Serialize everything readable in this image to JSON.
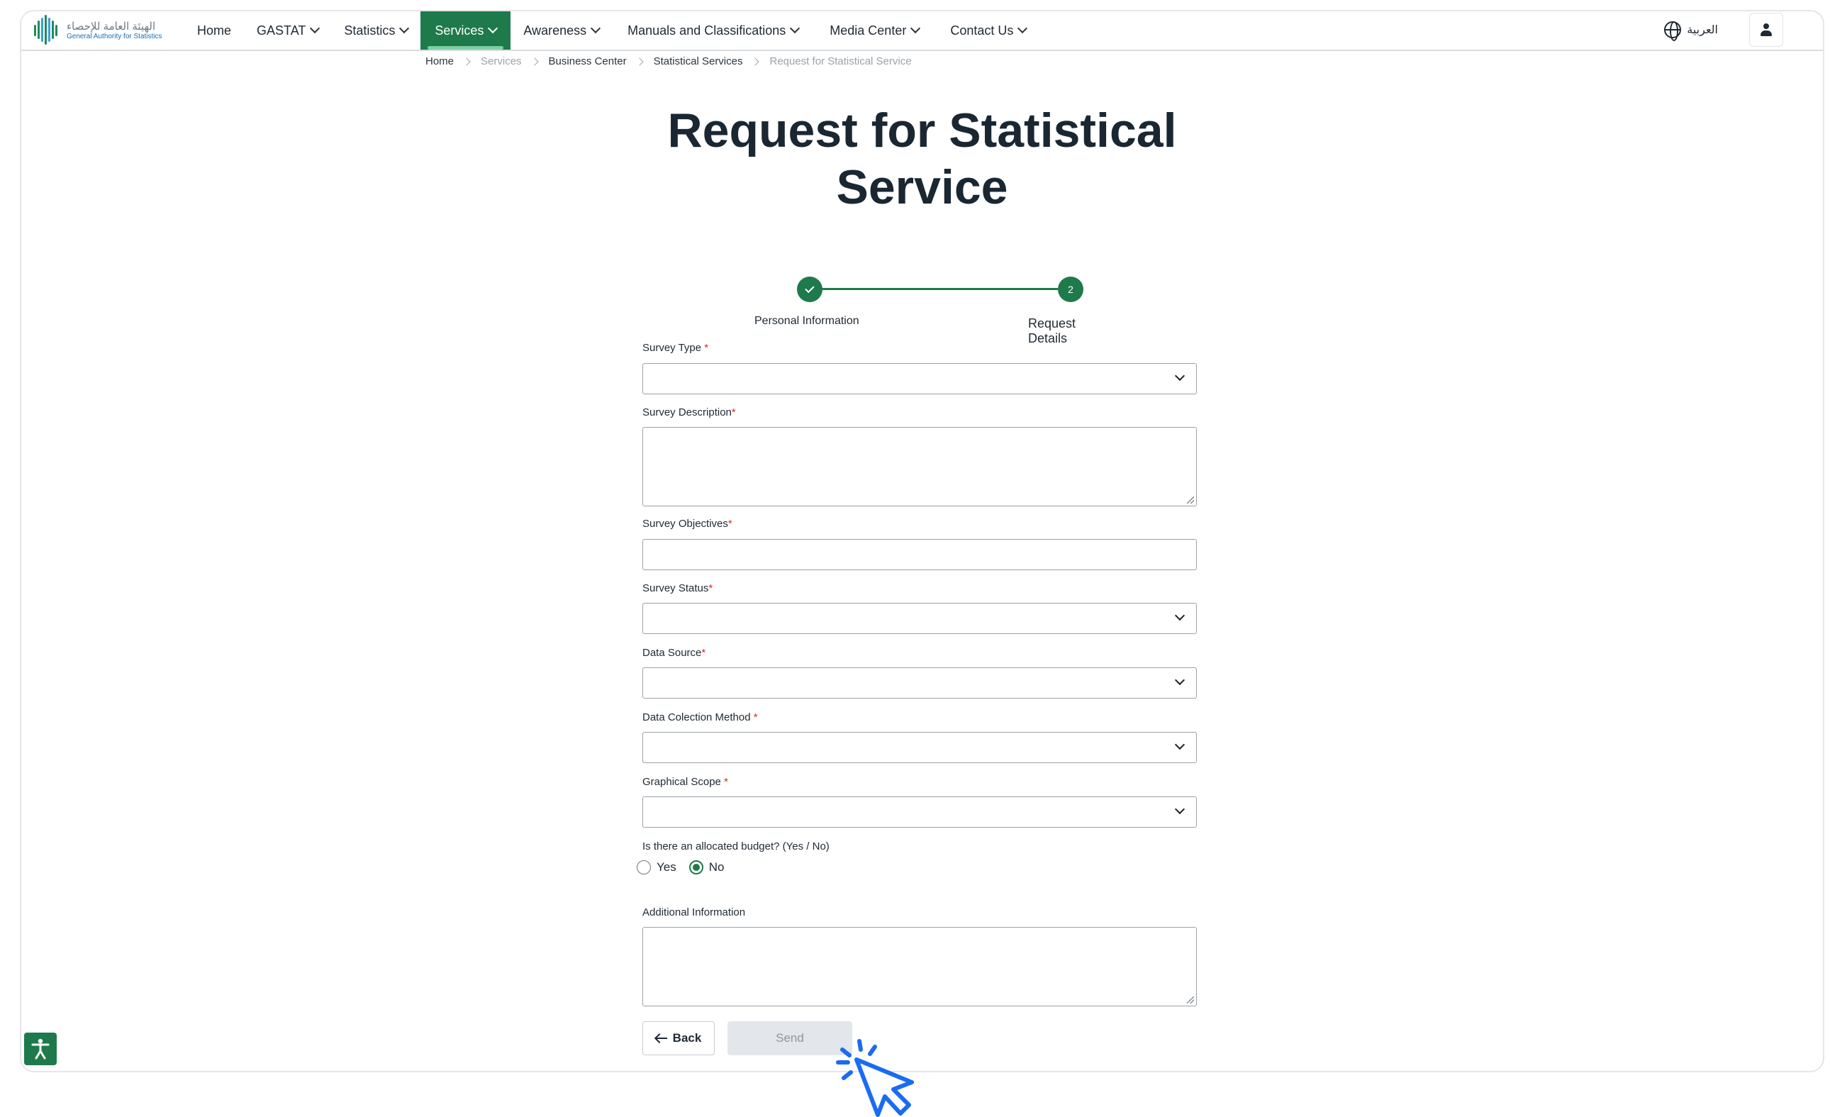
{
  "logo": {
    "arabic": "الهيئة العامة للإحصاء",
    "english": "General Authority for Statistics"
  },
  "nav": {
    "items": [
      "Home",
      "GASTAT",
      "Statistics",
      "Services",
      "Awareness",
      "Manuals and Classifications",
      "Media Center",
      "Contact Us"
    ],
    "active": "Services",
    "language": "العربية"
  },
  "breadcrumb": [
    "Home",
    "Services",
    "Business Center",
    "Statistical Services",
    "Request for Statistical Service"
  ],
  "page": {
    "title_line1": "Request for Statistical",
    "title_line2": "Service"
  },
  "stepper": {
    "steps": [
      {
        "label": "Personal Information",
        "state": "completed"
      },
      {
        "label": "Request Details",
        "number": "2",
        "state": "current"
      }
    ]
  },
  "form": {
    "survey_type": {
      "label": "Survey Type",
      "value": ""
    },
    "survey_description": {
      "label": "Survey Description",
      "value": ""
    },
    "survey_objectives": {
      "label": "Survey Objectives",
      "value": ""
    },
    "survey_status": {
      "label": "Survey Status",
      "value": ""
    },
    "data_source": {
      "label": "Data Source",
      "value": ""
    },
    "data_collection_method": {
      "label": "Data Colection Method",
      "value": ""
    },
    "graphical_scope": {
      "label": "Graphical Scope",
      "value": ""
    },
    "budget": {
      "label": "Is there an allocated budget? (Yes / No)",
      "options": [
        "Yes",
        "No"
      ],
      "selected": "No"
    },
    "additional_information": {
      "label": "Additional Information",
      "value": ""
    },
    "back_label": "Back",
    "send_label": "Send"
  },
  "colors": {
    "brand_green": "#1e7a4a",
    "required_red": "#d12b2b",
    "cursor_blue": "#1a6cf0",
    "disabled_bg": "#e3e6ea"
  }
}
